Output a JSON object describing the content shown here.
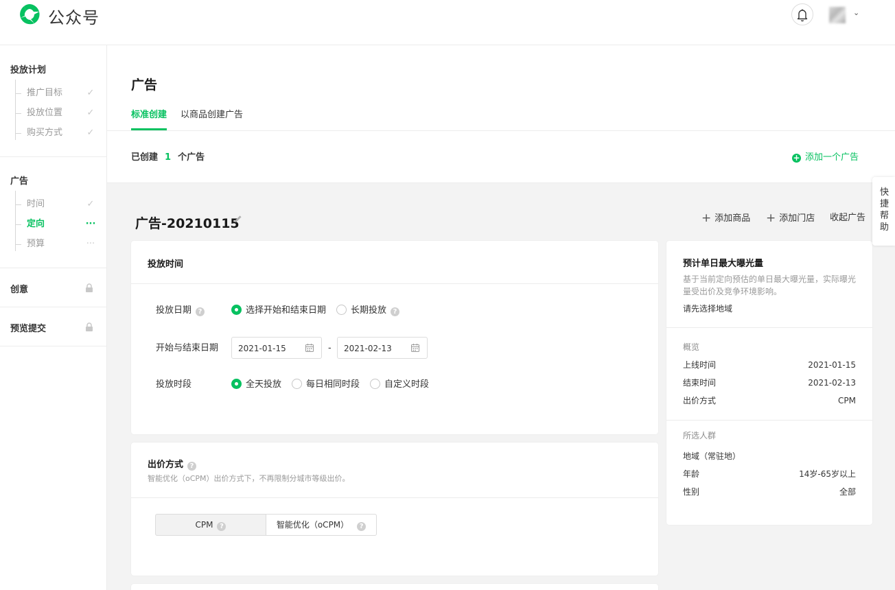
{
  "header": {
    "logo_text": "公众号",
    "brand_color": "#07c160"
  },
  "sidebar": {
    "sections": [
      {
        "title": "投放计划",
        "steps": [
          {
            "label": "推广目标",
            "status": "check"
          },
          {
            "label": "投放位置",
            "status": "check"
          },
          {
            "label": "购买方式",
            "status": "check"
          }
        ]
      },
      {
        "title": "广告",
        "steps": [
          {
            "label": "时间",
            "status": "check"
          },
          {
            "label": "定向",
            "status": "active"
          },
          {
            "label": "预算",
            "status": "pending"
          }
        ]
      },
      {
        "title": "创意",
        "locked": true
      },
      {
        "title": "预览提交",
        "locked": true
      }
    ],
    "icons": {
      "check": "check-icon",
      "pending": "more-dots-icon",
      "lock": "lock-icon"
    }
  },
  "main": {
    "title": "广告",
    "tabs": [
      {
        "label": "标准创建",
        "active": true
      },
      {
        "label": "以商品创建广告",
        "active": false
      }
    ],
    "created_prefix": "已创建",
    "created_count": "1",
    "created_suffix": "个广告",
    "add_ad_label": "添加一个广告",
    "ad_name": "广告-20210115",
    "actions": {
      "add_product": "添加商品",
      "add_store": "添加门店",
      "collapse": "收起广告"
    }
  },
  "time_card": {
    "title": "投放时间",
    "date_label": "投放日期",
    "date_options": [
      {
        "label": "选择开始和结束日期",
        "selected": true
      },
      {
        "label": "长期投放",
        "selected": false
      }
    ],
    "range_label": "开始与结束日期",
    "start_date": "2021-01-15",
    "range_sep": "-",
    "end_date": "2021-02-13",
    "period_label": "投放时段",
    "period_options": [
      {
        "label": "全天投放",
        "selected": true
      },
      {
        "label": "每日相同时段",
        "selected": false
      },
      {
        "label": "自定义时段",
        "selected": false
      }
    ]
  },
  "bid_card": {
    "title": "出价方式",
    "desc": "智能优化（oCPM）出价方式下，不再限制分城市等级出价。",
    "options": [
      {
        "label": "CPM",
        "selected": true
      },
      {
        "label": "智能优化（oCPM）",
        "selected": false
      }
    ]
  },
  "estimate": {
    "title": "预计单日最大曝光量",
    "desc": "基于当前定向预估的单日最大曝光量，实际曝光量受出价及竞争环境影响。",
    "hint": "请先选择地域",
    "overview_label": "概览",
    "overview": [
      {
        "k": "上线时间",
        "v": "2021-01-15"
      },
      {
        "k": "结束时间",
        "v": "2021-02-13"
      },
      {
        "k": "出价方式",
        "v": "CPM"
      }
    ],
    "audience_label": "所选人群",
    "audience": [
      {
        "k": "地域（常驻地）",
        "v": ""
      },
      {
        "k": "年龄",
        "v": "14岁-65岁以上"
      },
      {
        "k": "性别",
        "v": "全部"
      }
    ]
  },
  "quick_help": "快捷帮助"
}
